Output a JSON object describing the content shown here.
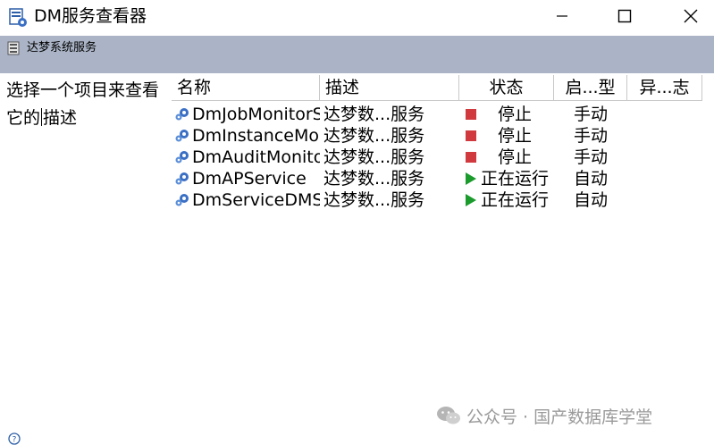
{
  "window": {
    "title": "DM服务查看器",
    "controls": {
      "minimize": "minimize-icon",
      "maximize": "maximize-icon",
      "close": "close-icon"
    }
  },
  "header": {
    "label": "达梦系统服务"
  },
  "description": {
    "line1": "选择一个项目来查看",
    "line2_a": "它的",
    "line2_b": "描述"
  },
  "columns": {
    "name": "名称",
    "desc": "描述",
    "state": "状态",
    "start": "启...型",
    "error": "异...志"
  },
  "services": [
    {
      "name": "DmJobMonitorService",
      "desc": "达梦数...服务",
      "state": "停止",
      "start": "手动",
      "state_icon": "stopped-icon"
    },
    {
      "name": "DmInstanceMonitorService",
      "desc": "达梦数...服务",
      "state": "停止",
      "start": "手动",
      "state_icon": "stopped-icon"
    },
    {
      "name": "DmAuditMonitorService",
      "desc": "达梦数...服务",
      "state": "停止",
      "start": "手动",
      "state_icon": "stopped-icon"
    },
    {
      "name": "DmAPService",
      "desc": "达梦数...服务",
      "state": "正在运行",
      "start": "自动",
      "state_icon": "running-icon"
    },
    {
      "name": "DmServiceDMSERVER",
      "desc": "达梦数...服务",
      "state": "正在运行",
      "start": "自动",
      "state_icon": "running-icon"
    }
  ],
  "watermark": {
    "text": "公众号 · 国产数据库学堂"
  },
  "colors": {
    "header_band": "#aab4c6",
    "stopped": "#d0393e",
    "running": "#1a9b2c",
    "service_icon": "#3a6fc4"
  }
}
